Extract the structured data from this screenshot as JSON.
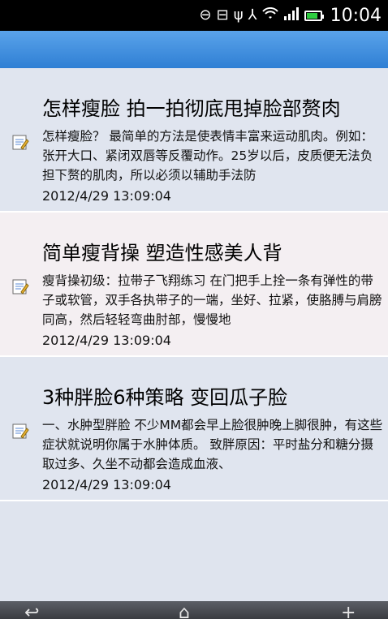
{
  "status_bar": {
    "time": "10:04",
    "icons": [
      "voicemail-icon",
      "bbm-icon",
      "usb-icon",
      "network-icon",
      "wifi-icon",
      "signal-icon",
      "battery-icon"
    ],
    "battery_level": 0.85,
    "battery_color": "#2ecc40"
  },
  "articles": [
    {
      "title": "怎样瘦脸 拍一拍彻底甩掉脸部赘肉",
      "summary": "怎样瘦脸？ 最简单的方法是使表情丰富来运动肌肉。例如：张开大口、紧闭双唇等反覆动作。25岁以后，皮质便无法负担下赘的肌肉，所以必须以辅助手法防",
      "date": "2012/4/29 13:09:04"
    },
    {
      "title": "简单瘦背操 塑造性感美人背",
      "summary": "瘦背操初级：拉带子飞翔练习 在门把手上拴一条有弹性的带子或软管，双手各执带子的一端，坐好、拉紧，使胳膊与肩膀同高，然后轻轻弯曲肘部，慢慢地",
      "date": "2012/4/29 13:09:04"
    },
    {
      "title": "3种胖脸6种策略 变回瓜子脸",
      "summary": "一、水肿型胖脸 不少MM都会早上脸很肿晚上脚很肿，有这些症状就说明你属于水肿体质。 致胖原因：平时盐分和糖分摄取过多、久坐不动都会造成血液、",
      "date": "2012/4/29 13:09:04"
    }
  ],
  "bottom_bar": {
    "icons": [
      "back-icon",
      "home-icon",
      "add-icon"
    ]
  }
}
